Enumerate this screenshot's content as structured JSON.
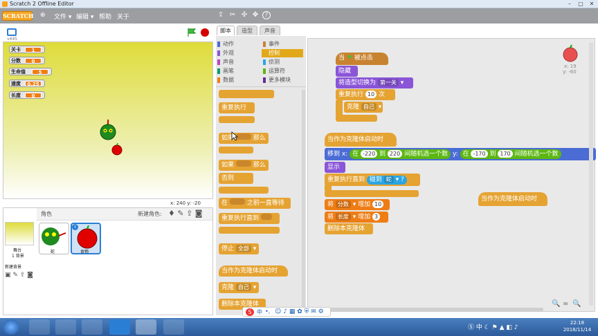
{
  "window": {
    "title": "Scratch 2 Offline Editor",
    "min": "–",
    "max": "▢",
    "close": "✕"
  },
  "menubar": {
    "logo": "SCRATCH",
    "globe": "⊕",
    "file": "文件 ▾",
    "edit": "编辑 ▾",
    "help": "帮助",
    "about": "关于"
  },
  "toolbar": {
    "duplicate": "⇪",
    "delete": "✂",
    "grow": "✣",
    "shrink": "✥",
    "help": "?"
  },
  "stage": {
    "version": "v445",
    "monitors": [
      {
        "label": "关卡",
        "value": "1"
      },
      {
        "label": "分数",
        "value": "0"
      },
      {
        "label": "生命值",
        "value": "5"
      },
      {
        "label": "速度",
        "value": "0.25"
      },
      {
        "label": "长度",
        "value": "0"
      }
    ],
    "coords": "x: 240  y: -20"
  },
  "sprites": {
    "header": "角色",
    "new_sprite": "新建角色:",
    "stage_label": "舞台",
    "stage_sub": "1 背景",
    "new_backdrop": "新建背景",
    "items": [
      {
        "name": "蛇"
      },
      {
        "name": "食物"
      }
    ]
  },
  "tabs": {
    "scripts": "脚本",
    "costumes": "造型",
    "sounds": "声音"
  },
  "categories": {
    "left": [
      {
        "label": "动作",
        "color": "#4a6cd4"
      },
      {
        "label": "外观",
        "color": "#8a55d7"
      },
      {
        "label": "声音",
        "color": "#bb42c3"
      },
      {
        "label": "画笔",
        "color": "#0e9a6c"
      },
      {
        "label": "数据",
        "color": "#ee7d16"
      }
    ],
    "right": [
      {
        "label": "事件",
        "color": "#c88330"
      },
      {
        "label": "控制",
        "color": "#e1a91a"
      },
      {
        "label": "侦测",
        "color": "#2ca5e2"
      },
      {
        "label": "运算符",
        "color": "#5cb712"
      },
      {
        "label": "更多模块",
        "color": "#632d99"
      }
    ]
  },
  "palette_blocks": {
    "repeat_forever": "重复执行",
    "if_then_if": "如果",
    "if_then_then": "那么",
    "if_else_if": "如果",
    "if_else_then": "那么",
    "if_else_else": "否则",
    "wait_until_pre": "在",
    "wait_until_post": "之前一直等待",
    "repeat_until": "重复执行直到",
    "stop": "停止",
    "stop_opt": "全部",
    "clone_start": "当作为克隆体启动时",
    "clone": "克隆",
    "clone_opt": "自己",
    "delete_clone": "删除本克隆体"
  },
  "script1": {
    "hat_pre": "当",
    "hat_post": "被点击",
    "hide": "隐藏",
    "switch_costume": "将造型切换为",
    "costume": "第一关",
    "repeat": "重复执行",
    "repeat_n": "10",
    "repeat_post": "次",
    "clone": "克隆",
    "clone_opt": "自己"
  },
  "script2": {
    "hat": "当作为克隆体启动时",
    "goto_pre": "移到 x:",
    "rand1_pre": "在",
    "rand1_a": "-220",
    "rand1_mid": "到",
    "rand1_b": "220",
    "rand1_post": "间随机选一个数",
    "goto_y": "y:",
    "rand2_pre": "在",
    "rand2_a": "-170",
    "rand2_mid": "到",
    "rand2_b": "170",
    "rand2_post": "间随机选一个数",
    "show": "显示",
    "repeat_until": "重复执行直到",
    "touching": "碰到",
    "touching_opt": "蛇",
    "touching_q": "?",
    "change1_pre": "将",
    "change1_var": "分数",
    "change1_mid": "增加",
    "change1_val": "10",
    "change2_pre": "将",
    "change2_var": "长度",
    "change2_mid": "增加",
    "change2_val": "3",
    "delete_clone": "删除本克隆体"
  },
  "script3": {
    "hat": "当作为克隆体启动时"
  },
  "sprite_info": {
    "x": "x: 19",
    "y": "y: -60"
  },
  "zoom": {
    "out": "🔍",
    "reset": "=",
    "in": "🔍"
  },
  "taskbar": {
    "time": "22:18",
    "date": "2018/11/14"
  },
  "ime": {
    "cn": "中",
    "dot": "•,"
  }
}
